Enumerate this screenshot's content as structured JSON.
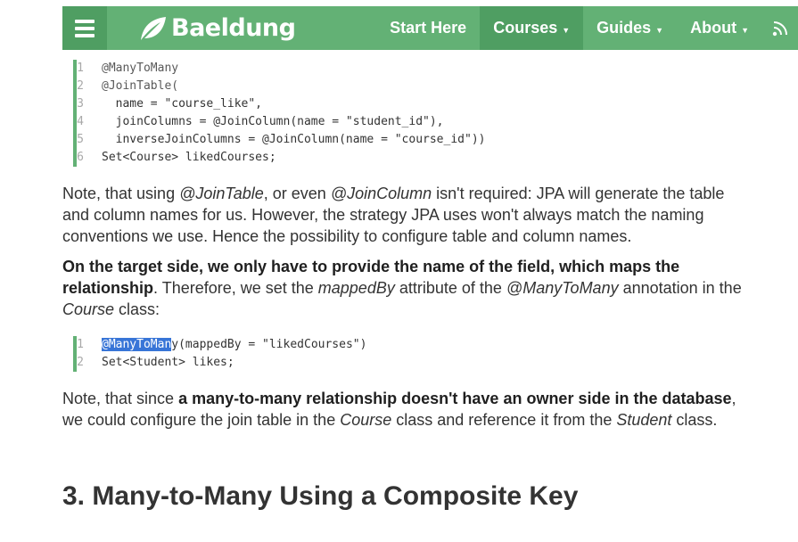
{
  "nav": {
    "logo_text": "Baeldung",
    "items": [
      {
        "label": "Start Here",
        "caret": ""
      },
      {
        "label": "Courses",
        "caret": "▼"
      },
      {
        "label": "Guides",
        "caret": "▼"
      },
      {
        "label": "About",
        "caret": "▼"
      }
    ],
    "icons": [
      "menu-icon",
      "leaf-logo-icon",
      "rss-icon"
    ],
    "colors": {
      "bar": "#63b175",
      "active": "#4f9e62",
      "accent": "#63b175"
    }
  },
  "code_block_1": {
    "lines": [
      {
        "n": "1",
        "text": "@ManyToMany"
      },
      {
        "n": "2",
        "text": "@JoinTable("
      },
      {
        "n": "3",
        "text": "  name = \"course_like\","
      },
      {
        "n": "4",
        "text": "  joinColumns = @JoinColumn(name = \"student_id\"),"
      },
      {
        "n": "5",
        "text": "  inverseJoinColumns = @JoinColumn(name = \"course_id\"))"
      },
      {
        "n": "6",
        "text": "Set<Course> likedCourses;"
      }
    ]
  },
  "para_1": {
    "t1": "Note, that using ",
    "i1": "@JoinTable",
    "t2": ", or even ",
    "i2": "@JoinColumn",
    "t3": " isn't required: JPA will generate the table and column names for us. However, the strategy JPA uses won't always match the naming conventions we use. Hence the possibility to configure table and column names."
  },
  "para_2": {
    "b1": "On the target side, we only have to provide the name of the field, which maps the relationship",
    "t1": ". Therefore, we set the ",
    "i1": "mappedBy",
    "t2": " attribute of the ",
    "i2": "@ManyToMany",
    "t3": " annotation in the ",
    "i3": "Course",
    "t4": " class:"
  },
  "code_block_2": {
    "line1_n": "1",
    "line1_selected": "@ManyToMan",
    "line1_rest": "y(mappedBy = \"likedCourses\")",
    "line2_n": "2",
    "line2_text": "Set<Student> likes;"
  },
  "para_3": {
    "t1": "Note, that since ",
    "b1": "a many-to-many relationship doesn't have an owner side in the database",
    "t2": ", we could configure the join table in the ",
    "i1": "Course",
    "t3": " class and reference it from the ",
    "i2": "Student",
    "t4": " class."
  },
  "heading": {
    "text": "3. Many-to-Many Using a Composite Key"
  }
}
